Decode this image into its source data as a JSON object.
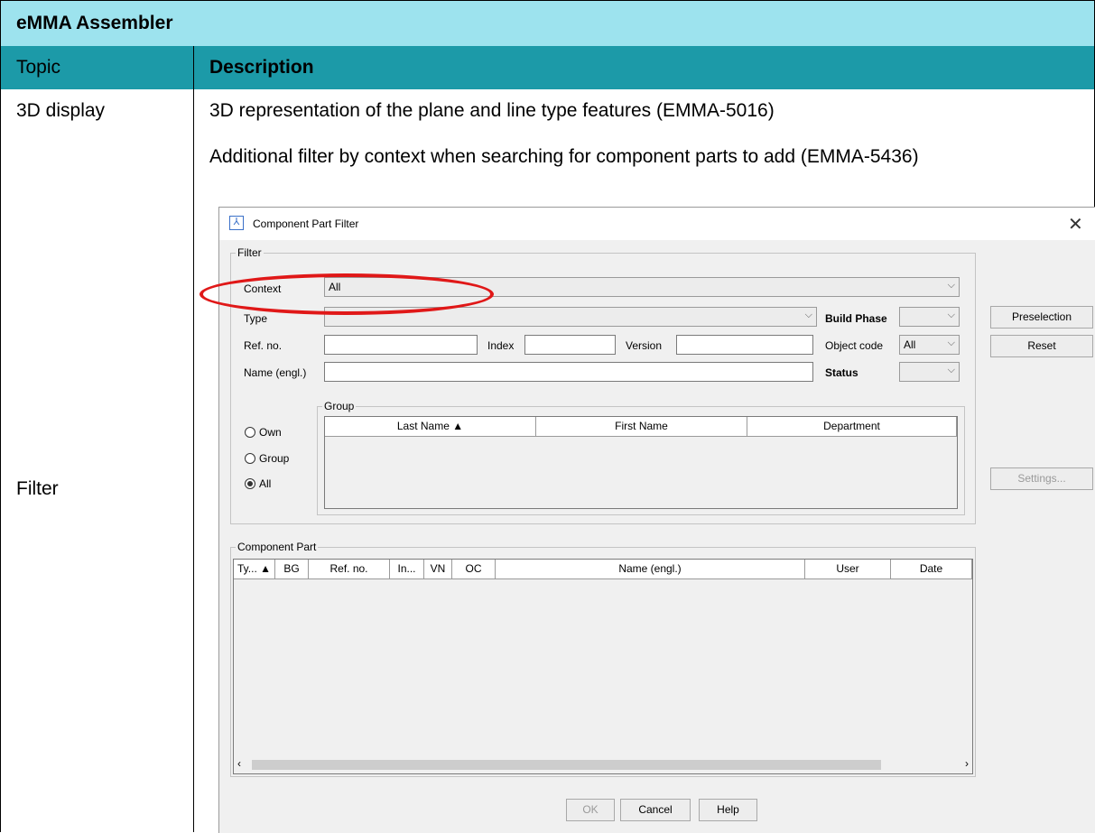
{
  "table": {
    "title": "eMMA Assembler",
    "header": {
      "col1": "Topic",
      "col2": "Description"
    },
    "rows": [
      {
        "topic": "3D display",
        "description": "3D representation of the plane and line type features (EMMA-5016)"
      },
      {
        "topic": "Filter",
        "description": "Additional filter by context when searching for component parts to add (EMMA-5436)"
      }
    ]
  },
  "dialog": {
    "title": "Component Part Filter",
    "filter_legend": "Filter",
    "context_label": "Context",
    "context_value": "All",
    "type_label": "Type",
    "build_phase_label": "Build Phase",
    "ref_no_label": "Ref. no.",
    "index_label": "Index",
    "version_label": "Version",
    "object_code_label": "Object code",
    "object_code_value": "All",
    "name_label": "Name (engl.)",
    "status_label": "Status",
    "group_legend": "Group",
    "group_columns": [
      "Last Name ▲",
      "First Name",
      "Department"
    ],
    "radios": {
      "own": "Own",
      "group": "Group",
      "all": "All"
    },
    "buttons": {
      "preselection": "Preselection",
      "reset": "Reset",
      "settings": "Settings...",
      "ok": "OK",
      "cancel": "Cancel",
      "help": "Help"
    },
    "component_legend": "Component Part",
    "component_columns": [
      "Ty... ▲",
      "BG",
      "Ref. no.",
      "In...",
      "VN",
      "OC",
      "Name (engl.)",
      "User",
      "Date"
    ]
  },
  "colors": {
    "title_bg": "#9de3ee",
    "header_bg": "#1c9aa8",
    "highlight": "#e01818"
  }
}
